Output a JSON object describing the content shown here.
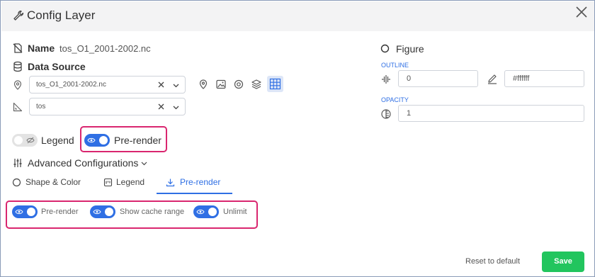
{
  "dialog": {
    "title": "Config Layer",
    "icons": {
      "title_icon": "wrench-icon",
      "close_icon": "close-icon"
    }
  },
  "name": {
    "label": "Name",
    "value": "tos_O1_2001-2002.nc"
  },
  "data_source": {
    "label": "Data Source",
    "file_select": {
      "value": "tos_O1_2001-2002.nc"
    },
    "variable_select": {
      "value": "tos"
    },
    "layer_type_icons": [
      "map-pin-icon",
      "image-icon",
      "target-icon",
      "layers-icon",
      "grid-icon"
    ]
  },
  "toggles": {
    "legend": {
      "label": "Legend",
      "on": false
    },
    "pre_render": {
      "label": "Pre-render",
      "on": true
    }
  },
  "advanced": {
    "label": "Advanced Configurations",
    "tabs": [
      {
        "label": "Shape & Color",
        "active": false
      },
      {
        "label": "Legend",
        "active": false
      },
      {
        "label": "Pre-render",
        "active": true
      }
    ],
    "pre_render_options": [
      {
        "label": "Pre-render",
        "on": true
      },
      {
        "label": "Show cache range",
        "on": true
      },
      {
        "label": "Unlimit",
        "on": true
      }
    ]
  },
  "figure": {
    "label": "Figure",
    "outline": {
      "label": "OUTLINE",
      "width": "0",
      "color": "#ffffff"
    },
    "opacity": {
      "label": "OPACITY",
      "value": "1"
    }
  },
  "footer": {
    "reset_label": "Reset to default",
    "save_label": "Save"
  },
  "colors": {
    "accent": "#2f6fe4",
    "save": "#22c55e",
    "highlight": "#d9266f"
  }
}
